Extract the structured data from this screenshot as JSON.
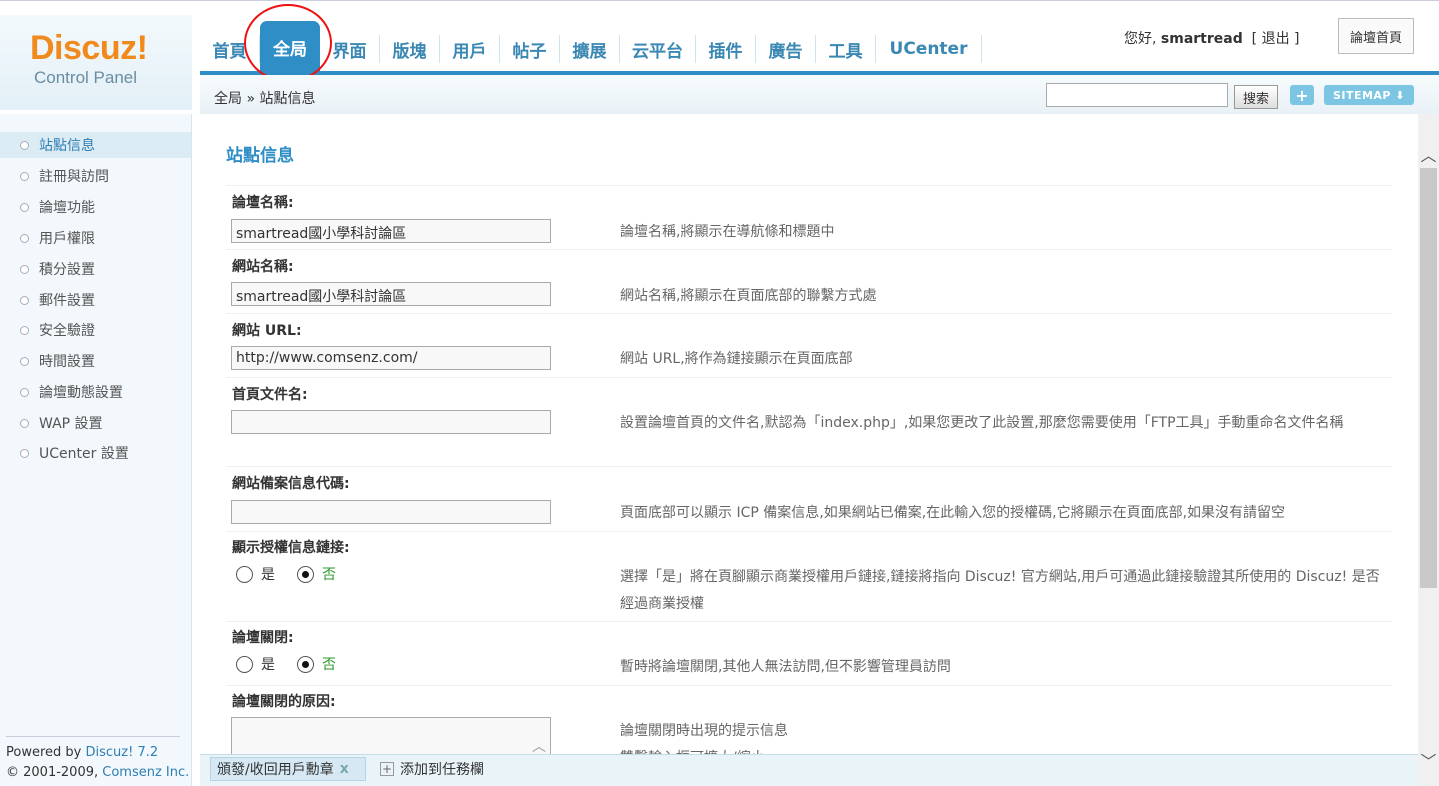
{
  "header": {
    "brand": "Discuz!",
    "subtitle": "Control Panel",
    "nav_tabs": [
      {
        "label": "首頁"
      },
      {
        "label": "全局"
      },
      {
        "label": "界面"
      },
      {
        "label": "版塊"
      },
      {
        "label": "用戶"
      },
      {
        "label": "帖子"
      },
      {
        "label": "擴展"
      },
      {
        "label": "云平台"
      },
      {
        "label": "插件"
      },
      {
        "label": "廣告"
      },
      {
        "label": "工具"
      },
      {
        "label": "UCenter"
      }
    ],
    "active_tab": "全局",
    "greeting": "您好,",
    "username": "smartread",
    "logout_label": "[ 退出 ]",
    "home_button": "論壇首頁",
    "breadcrumb": "全局 » 站點信息",
    "search_button": "搜索",
    "plus_button": "+",
    "sitemap_button": "SITEMAP ⬇"
  },
  "sidebar": {
    "items": [
      {
        "label": "站點信息"
      },
      {
        "label": "註冊與訪問"
      },
      {
        "label": "論壇功能"
      },
      {
        "label": "用戶權限"
      },
      {
        "label": "積分設置"
      },
      {
        "label": "郵件設置"
      },
      {
        "label": "安全驗證"
      },
      {
        "label": "時間設置"
      },
      {
        "label": "論壇動態設置"
      },
      {
        "label": "WAP 設置"
      },
      {
        "label": "UCenter 設置"
      }
    ],
    "active_item": "站點信息",
    "powered_prefix": "Powered by",
    "powered_link": "Discuz! 7.2",
    "copyright_prefix": "© 2001-2009,",
    "copyright_link": "Comsenz Inc."
  },
  "main": {
    "title": "站點信息",
    "fields": {
      "forum_name": {
        "label": "論壇名稱:",
        "value": "smartread國小學科討論區",
        "desc": "論壇名稱,將顯示在導航條和標題中"
      },
      "site_name": {
        "label": "網站名稱:",
        "value": "smartread國小學科討論區",
        "desc": "網站名稱,將顯示在頁面底部的聯繫方式處"
      },
      "site_url": {
        "label": "網站 URL:",
        "value": "http://www.comsenz.com/",
        "desc": "網站 URL,將作為鏈接顯示在頁面底部"
      },
      "index_file": {
        "label": "首頁文件名:",
        "value": "",
        "desc": "設置論壇首頁的文件名,默認為「index.php」,如果您更改了此設置,那麼您需要使用「FTP工具」手動重命名文件名稱"
      },
      "icp": {
        "label": "網站備案信息代碼:",
        "value": "",
        "desc": "頁面底部可以顯示 ICP 備案信息,如果網站已備案,在此輸入您的授權碼,它將顯示在頁面底部,如果沒有請留空"
      },
      "license_link": {
        "label": "顯示授權信息鏈接:",
        "yes": "是",
        "no": "否",
        "selected": "否",
        "desc": "選擇「是」將在頁腳顯示商業授權用戶鏈接,鏈接將指向 Discuz! 官方網站,用戶可通過此鏈接驗證其所使用的 Discuz! 是否經過商業授權"
      },
      "forum_closed": {
        "label": "論壇關閉:",
        "yes": "是",
        "no": "否",
        "selected": "否",
        "desc": "暫時將論壇關閉,其他人無法訪問,但不影響管理員訪問"
      },
      "close_reason": {
        "label": "論壇關閉的原因:",
        "desc": "論壇關閉時出現的提示信息",
        "desc2": "雙擊輸入框可擴大/縮小"
      }
    }
  },
  "taskbar": {
    "task1": "頒發/收回用戶勳章",
    "task1_close": "x",
    "task2": "添加到任務欄",
    "task2_icon": "+"
  },
  "scrollbar": {
    "up": "︿",
    "down": "﹀"
  }
}
